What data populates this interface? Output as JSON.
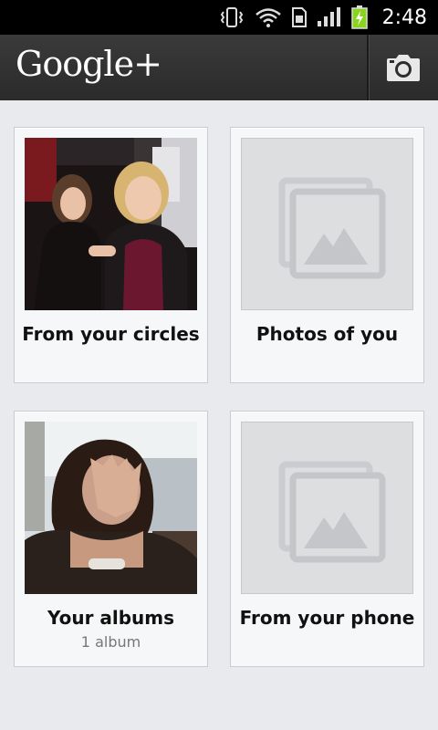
{
  "status_bar": {
    "time": "2:48",
    "icons": [
      "vibrate-icon",
      "wifi-icon",
      "sim-icon",
      "signal-icon",
      "battery-charging-icon"
    ]
  },
  "app_bar": {
    "brand": "Google+",
    "camera_icon": "camera-icon"
  },
  "tiles": [
    {
      "title": "From your circles",
      "subtitle": ""
    },
    {
      "title": "Photos of you",
      "subtitle": ""
    },
    {
      "title": "Your albums",
      "subtitle": "1 album"
    },
    {
      "title": "From your phone",
      "subtitle": ""
    }
  ],
  "colors": {
    "background": "#e8eaed",
    "app_bar": "#2e2e2e",
    "status_bar": "#000000",
    "battery": "#8bd41d"
  }
}
